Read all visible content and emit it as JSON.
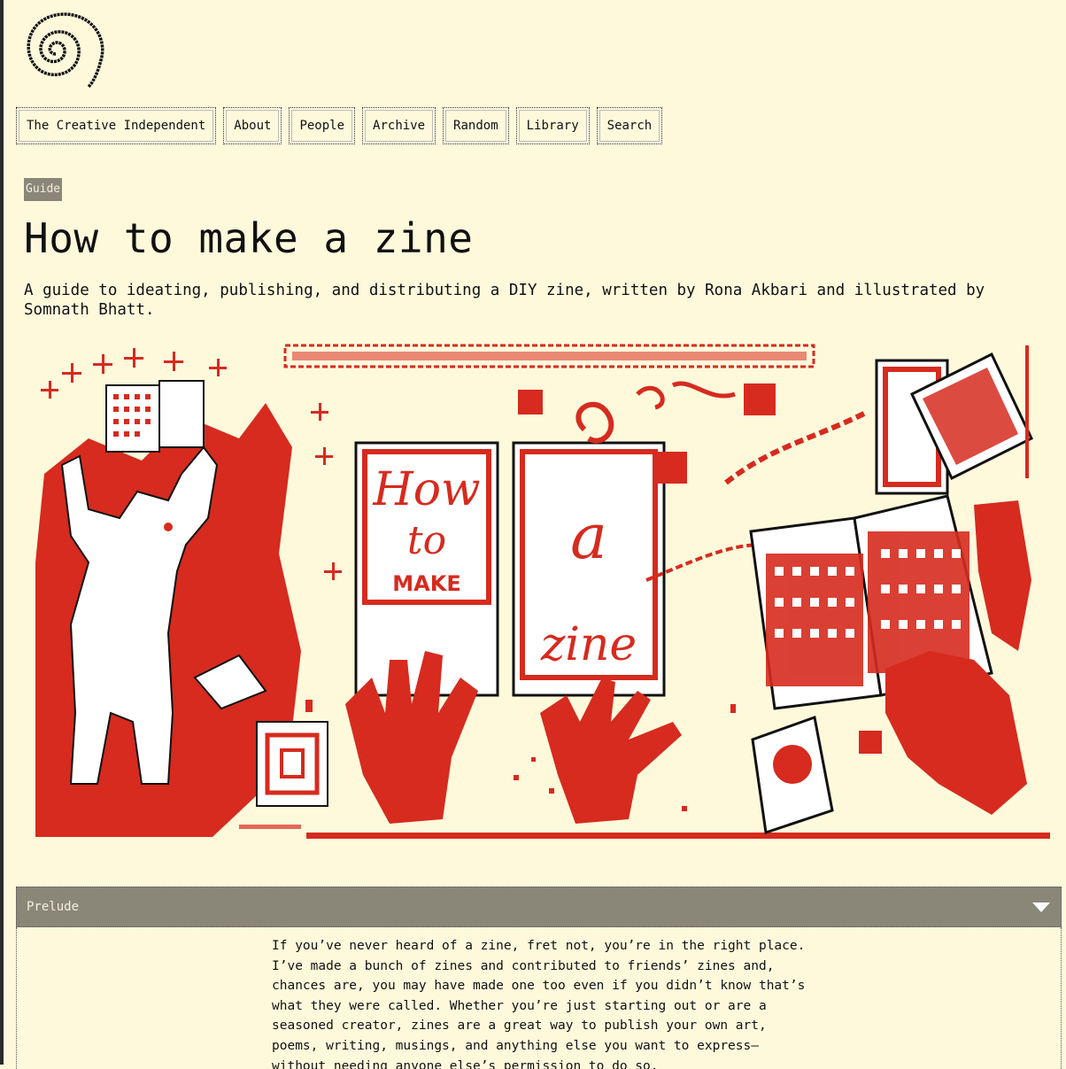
{
  "nav": {
    "items": [
      "The Creative Independent",
      "About",
      "People",
      "Archive",
      "Random",
      "Library",
      "Search"
    ]
  },
  "article": {
    "category": "Guide",
    "title": "How to make a zine",
    "subtitle": "A guide to ideating, publishing, and distributing a DIY zine, written by Rona Akbari and illustrated by Somnath Bhatt."
  },
  "illustration": {
    "lettering_left": [
      "How",
      "to",
      "MAKE"
    ],
    "lettering_right": [
      "a",
      "zine"
    ]
  },
  "section": {
    "label": "Prelude",
    "text": "If you’ve never heard of a zine, fret not, you’re in the right place. I’ve made a bunch of zines and contributed to friends’ zines and, chances are, you may have made one too even if you didn’t know that’s what they were called. Whether you’re just starting out or are a seasoned creator, zines are a great way to publish your own art, poems, writing, musings, and anything else you want to express— without needing anyone else’s permission to do so."
  },
  "colors": {
    "background": "#fff9dc",
    "accent_red": "#d62b1e",
    "header_gray": "#8a8678"
  },
  "icons": {
    "logo": "spiral-logo-icon",
    "toggle": "triangle-down-icon"
  }
}
